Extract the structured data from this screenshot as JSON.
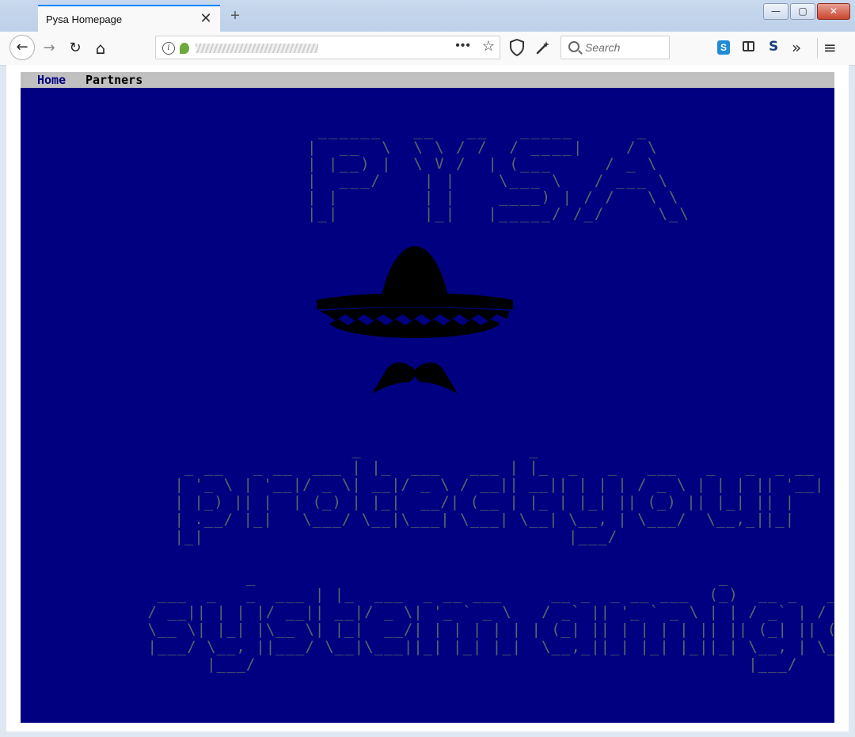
{
  "browser": {
    "tab_title": "Pysa Homepage",
    "tab_close": "✕",
    "new_tab": "+",
    "search_placeholder": "Search",
    "window_controls": {
      "minimize": "—",
      "maximize": "▢",
      "close": "✕"
    },
    "url_more": "•••",
    "toolbar_glyphs": {
      "back": "←",
      "forward": "→",
      "reload": "↻",
      "home": "⌂",
      "star": "☆",
      "overflow": "»",
      "menu": "≡"
    }
  },
  "site": {
    "nav": {
      "home": "Home",
      "partners": "Partners"
    },
    "ascii_title": " ______   __   __   _____      _\n|  __  \\  \\ \\ / /  / ____|    / \\\n| |__) |  \\ V /  | (___     / _ \\\n|  ___/    | |    \\___ \\   / ___ \\\n| |        | |    ____) | / /   \\ \\\n|_|        |_|   |_____/ /_/     \\_\\",
    "ascii_slogan_line1": "                   _                 _\n  _ __   _ __  ___ | |_  ___   ___ | |_  _   _   ___   _   _  _ __\n | '_ \\ | '__|/ _ \\| __|/ _ \\ / __|| __|| | | | / _ \\ | | | || '__|\n | |_) || |  | (_) | |_|  __/| (__ | |_ | |_| || (_) || |_| || |\n | .__/ |_|   \\___/ \\__|\\___| \\___| \\__| \\__, | \\___/  \\__,_||_|\n |_|                                     |___/",
    "ascii_slogan_line2": "           _                                               _\n  ___  _   _  ___ | |_  ___  _ __ ___     __ _  _ __ ___  (_)  __ _   ___\n / __|| | | |/ __|| __|/ _ \\| '_ ` _ \\   / _` || '_ ` _ \\ | | / _` | / _ \\\n \\__ \\| |_| |\\__ \\| |_|  __/| | | | | | | (_| || | | | | || || (_| || (_) |\n |___/ \\__, ||___/ \\__|\\___||_| |_| |_|  \\__,_||_| |_| |_||_| \\__, | \\___/\n       |___/                                                  |___/"
  },
  "colors": {
    "page_background": "#000080",
    "ascii_text": "#5c6668",
    "nav_bar": "#c0c0c0",
    "nav_home_link": "#000080",
    "logo_fill": "#000000"
  },
  "icons": {
    "logo": "sombrero-and-mustache",
    "toolbar": [
      "back-icon",
      "forward-icon",
      "reload-icon",
      "home-icon",
      "page-info-icon",
      "bookmark-star-icon",
      "shield-icon",
      "wand-icon",
      "search-icon",
      "skype-icon",
      "sidebar-icon",
      "extension-s-icon",
      "overflow-chevron-icon",
      "hamburger-menu-icon"
    ]
  }
}
